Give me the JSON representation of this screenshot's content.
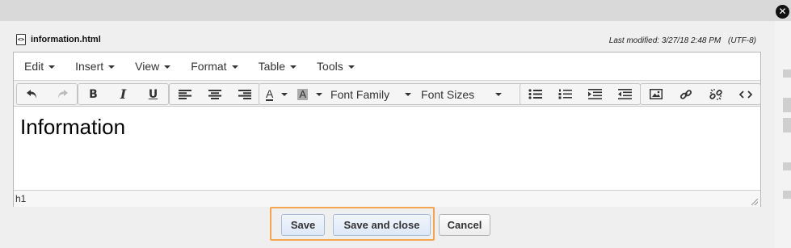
{
  "file": {
    "name": "information.html",
    "last_modified": "Last modified: 3/27/18 2:48 PM",
    "encoding": "(UTF-8)"
  },
  "menubar": [
    {
      "label": "Edit"
    },
    {
      "label": "Insert"
    },
    {
      "label": "View"
    },
    {
      "label": "Format"
    },
    {
      "label": "Table"
    },
    {
      "label": "Tools"
    }
  ],
  "toolbar": {
    "undo": "undo-icon",
    "redo": "redo-icon",
    "bold": "B",
    "italic": "I",
    "underline": "U",
    "text_color": "A",
    "bg_color": "A",
    "font_family": "Font Family",
    "font_sizes": "Font Sizes"
  },
  "content": {
    "heading": "Information"
  },
  "status": {
    "path": "h1"
  },
  "footer": {
    "save": "Save",
    "save_and_close": "Save and close",
    "cancel": "Cancel"
  },
  "colors": {
    "highlight": "#f3a552",
    "primary_button": "#dde8f7"
  }
}
